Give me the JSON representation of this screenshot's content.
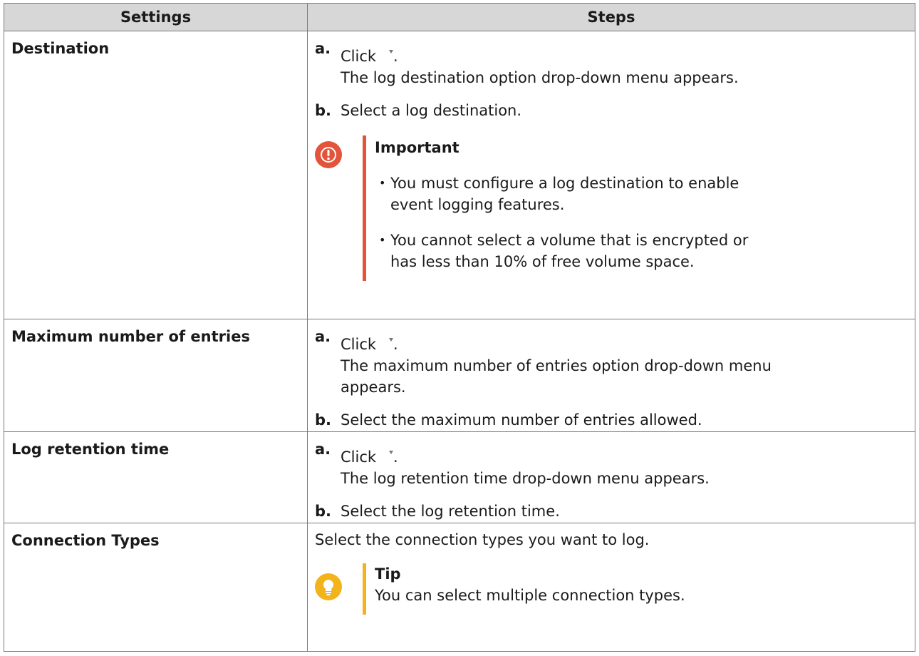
{
  "table": {
    "headers": {
      "settings": "Settings",
      "steps": "Steps"
    },
    "rows": [
      {
        "setting": "Destination",
        "step_a_label": "a.",
        "step_a_click": "Click",
        "step_a_dot": ".",
        "step_a_result": "The log destination option drop-down menu appears.",
        "step_b_label": "b.",
        "step_b_text": "Select a log destination.",
        "important": {
          "title": "Important",
          "bullets": [
            "You must configure a log destination to enable event logging features.",
            "You cannot select a volume that is encrypted or has less than 10% of free volume space."
          ]
        }
      },
      {
        "setting": "Maximum number of entries",
        "step_a_label": "a.",
        "step_a_click": "Click",
        "step_a_dot": ".",
        "step_a_result": "The maximum number of entries option drop-down menu appears.",
        "step_b_label": "b.",
        "step_b_text": "Select the maximum number of entries allowed."
      },
      {
        "setting": "Log retention time",
        "step_a_label": "a.",
        "step_a_click": "Click",
        "step_a_dot": ".",
        "step_a_result": "The log retention time drop-down menu appears.",
        "step_b_label": "b.",
        "step_b_text": "Select the log retention time."
      },
      {
        "setting": "Connection Types",
        "intro": "Select the connection types you want to log.",
        "tip": {
          "title": "Tip",
          "text": "You can select multiple connection types."
        }
      }
    ]
  },
  "colors": {
    "header_bg": "#d7d7d7",
    "important_accent": "#e2543b",
    "tip_accent": "#f2b31b"
  }
}
